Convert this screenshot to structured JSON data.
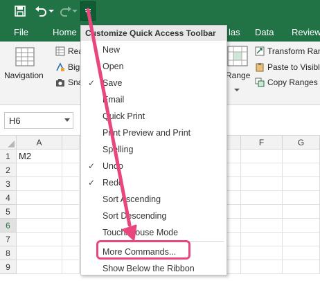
{
  "qat": {
    "save_icon": "save-icon",
    "undo_icon": "undo-icon",
    "redo_icon": "redo-icon",
    "customize_icon": "chevron-down-icon"
  },
  "tabs": [
    "File",
    "Home",
    "las",
    "Data",
    "Review"
  ],
  "ribbon": {
    "navigation": "Navigation",
    "rea": "Rea",
    "big": "Big",
    "sna": "Sna",
    "range": "Range",
    "transform": "Transform Ran",
    "paste_visible": "Paste to Visibl",
    "copy_ranges": "Copy Ranges"
  },
  "namebox": {
    "value": "H6"
  },
  "grid": {
    "columns": [
      "A",
      "F",
      "G"
    ],
    "rows": [
      "1",
      "2",
      "3",
      "4",
      "5",
      "6",
      "7",
      "8",
      "9"
    ],
    "active_row": "6",
    "cells": {
      "A1": "M2"
    }
  },
  "menu": {
    "title": "Customize Quick Access Toolbar",
    "items": [
      {
        "label": "New",
        "checked": false
      },
      {
        "label": "Open",
        "checked": false
      },
      {
        "label": "Save",
        "checked": true
      },
      {
        "label": "Email",
        "checked": false
      },
      {
        "label": "Quick Print",
        "checked": false
      },
      {
        "label": "Print Preview and Print",
        "checked": false
      },
      {
        "label": "Spelling",
        "checked": false
      },
      {
        "label": "Undo",
        "checked": true
      },
      {
        "label": "Redo",
        "checked": true
      },
      {
        "label": "Sort Ascending",
        "checked": false
      },
      {
        "label": "Sort Descending",
        "checked": false
      },
      {
        "label": "Touch/Mouse Mode",
        "checked": false
      },
      {
        "label": "More Commands...",
        "checked": false
      },
      {
        "label": "Show Below the Ribbon",
        "checked": false
      }
    ],
    "check_glyph": "✓"
  },
  "colors": {
    "excel_green": "#217346",
    "annotation_pink": "#e8467c"
  }
}
